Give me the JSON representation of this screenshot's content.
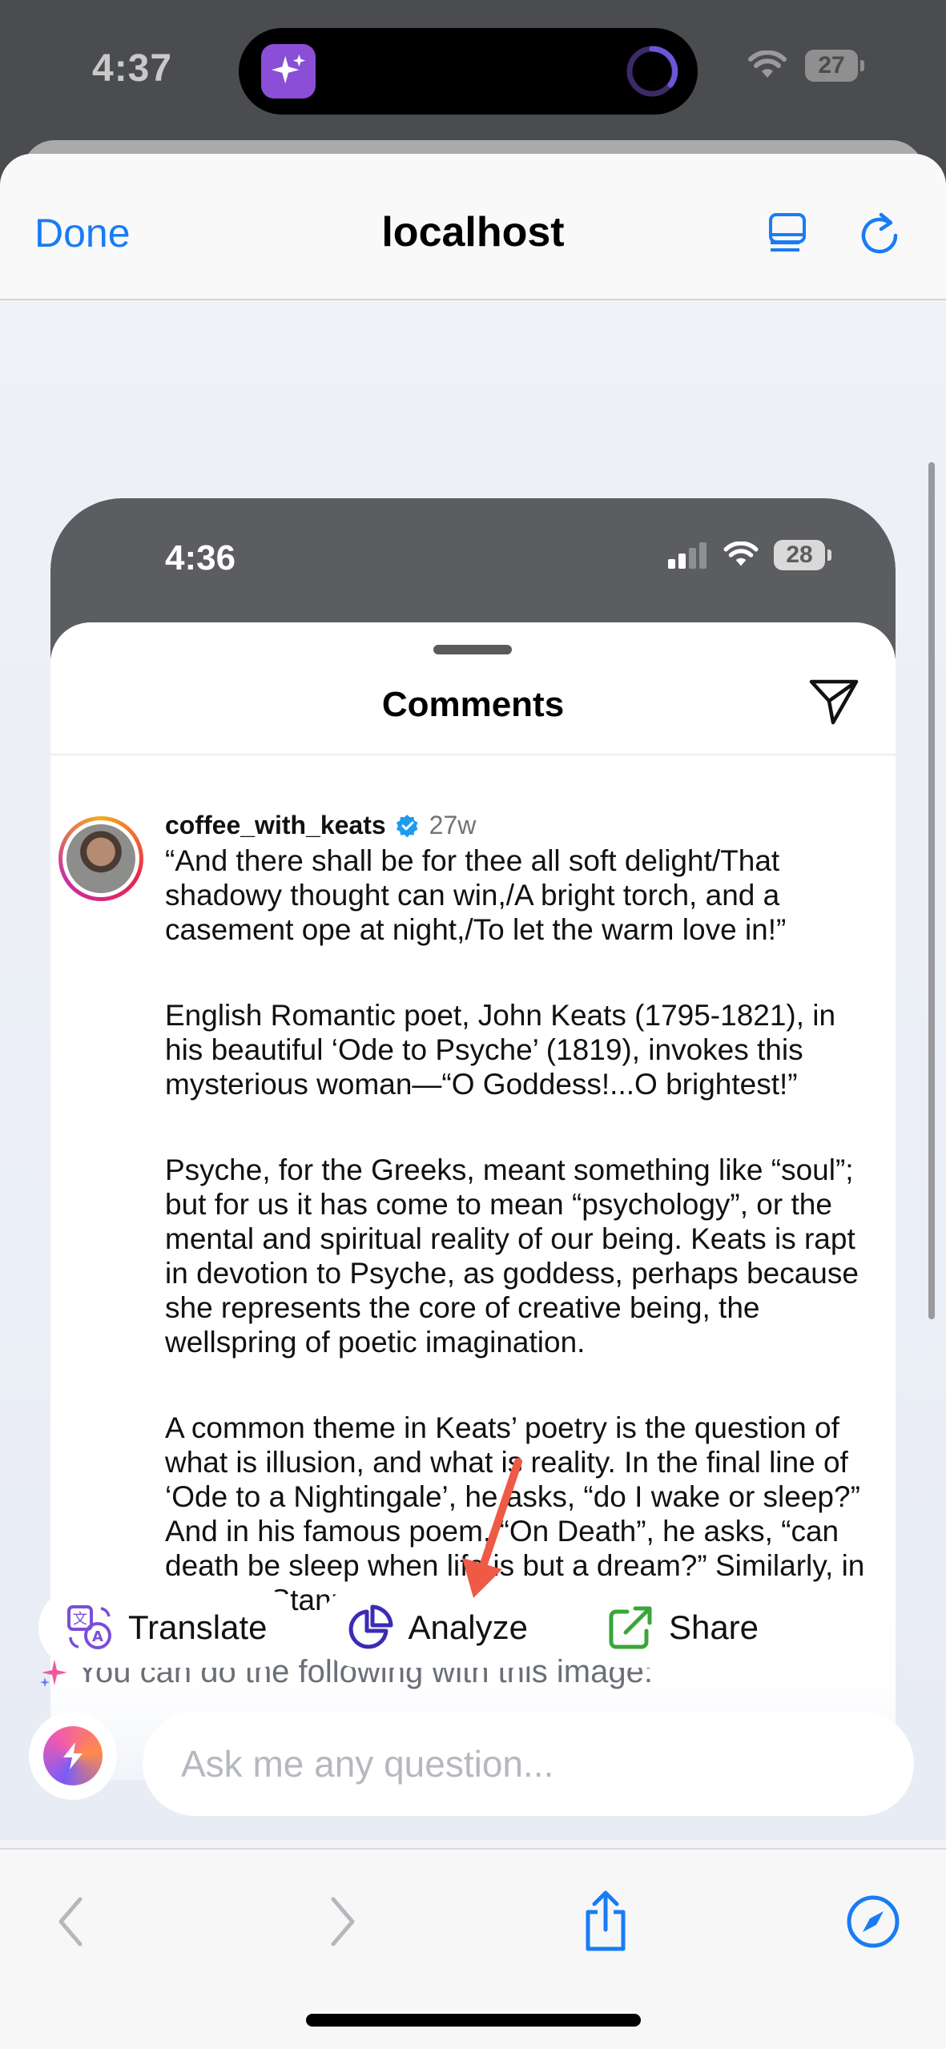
{
  "status_bar": {
    "time": "4:37",
    "battery": "27"
  },
  "nav": {
    "done_label": "Done",
    "title": "localhost"
  },
  "screenshot": {
    "time": "4:36",
    "battery": "28",
    "panel_title": "Comments",
    "comment": {
      "username": "coffee_with_keats",
      "age": "27w",
      "paragraphs": [
        "“And there shall be for thee all soft delight/That shadowy thought can win,/A bright torch, and a casement ope at night,/To let the warm love in!”",
        "English Romantic poet, John Keats (1795-1821), in his beautiful ‘Ode to Psyche’ (1819), invokes this mysterious woman—“O Goddess!...O brightest!”",
        "Psyche, for the Greeks, meant something like “soul”; but for us it has come to mean “psychology”, or the mental and spiritual reality of our being. Keats is rapt in devotion to Psyche, as goddess, perhaps because she represents the core of creative being, the wellspring of poetic imagination.",
        "A common theme in Keats’ poetry is the question of what is illusion, and what is reality. In the final line of ‘Ode to a Nightingale’, he asks, “do I wake or sleep?” And in his famous poem, “On Death”, he asks, “can death be sleep when life is but a dream?” Similarly, in the first Stanza of this Ode,"
      ]
    }
  },
  "assistant": {
    "hint": "You can do the following with this image:",
    "actions": [
      {
        "label": "Translate",
        "icon": "translate-icon",
        "color": "#7a4fd6"
      },
      {
        "label": "Analyze",
        "icon": "pie-chart-icon",
        "color": "#3b2bb5"
      },
      {
        "label": "Share",
        "icon": "share-external-icon",
        "color": "#3aa63a"
      }
    ],
    "input_placeholder": "Ask me any question..."
  },
  "colors": {
    "accent": "#1a7cf5",
    "annotation_arrow": "#ee5a45"
  }
}
